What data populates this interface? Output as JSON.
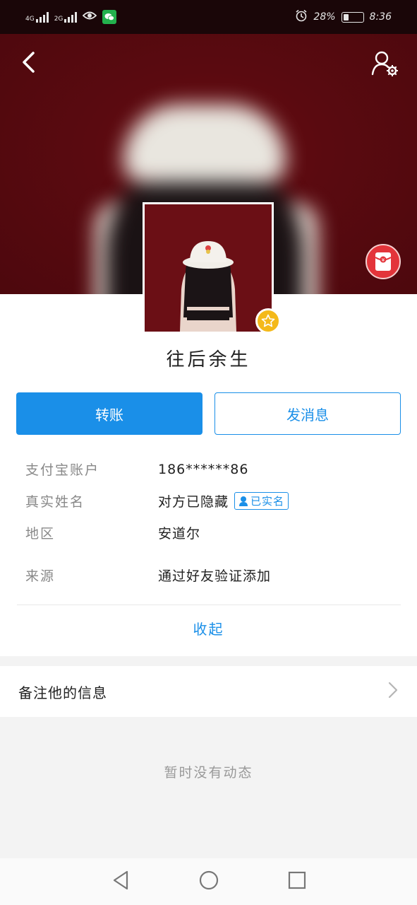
{
  "status_bar": {
    "network_1": "4G",
    "network_2": "2G",
    "battery_percent": "28%",
    "battery_level": 0.28,
    "time": "8:36",
    "icons": [
      "signal-icon",
      "eye-icon",
      "wechat-icon",
      "alarm-icon",
      "battery-icon"
    ]
  },
  "header": {
    "back_icon": "chevron-left-icon",
    "settings_icon": "user-settings-icon",
    "red_packet_icon": "red-packet-icon"
  },
  "profile": {
    "nickname": "往后余生",
    "badge_icon": "star-icon"
  },
  "actions": {
    "transfer_label": "转账",
    "message_label": "发消息"
  },
  "info": {
    "account_label": "支付宝账户",
    "account_value": "186******86",
    "realname_label": "真实姓名",
    "realname_value": "对方已隐藏",
    "verified_badge": "已实名",
    "region_label": "地区",
    "region_value": "安道尔",
    "source_label": "来源",
    "source_value": "通过好友验证添加",
    "collapse_label": "收起"
  },
  "remark": {
    "label": "备注他的信息"
  },
  "feed": {
    "empty_text": "暂时没有动态"
  },
  "colors": {
    "accent": "#1a8fe8",
    "hero_bg": "#5a0a10",
    "red_packet": "#e3343a",
    "badge_gold": "#f4b91a"
  }
}
